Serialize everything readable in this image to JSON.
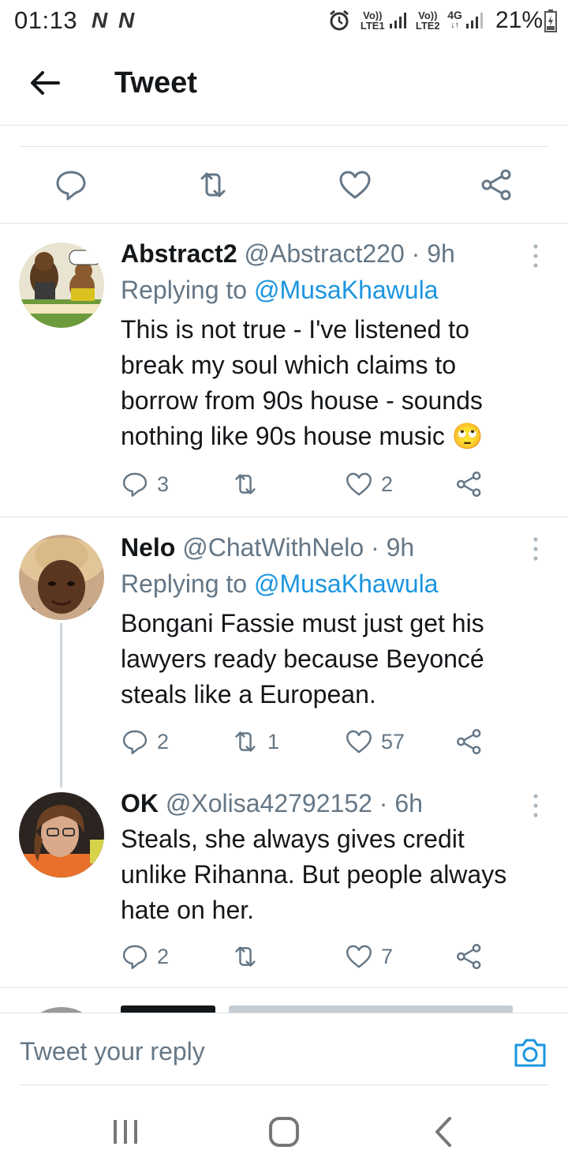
{
  "status_bar": {
    "time": "01:13",
    "n_icons": [
      "N",
      "N"
    ],
    "sim1_label": "Vo)) LTE1",
    "sim2_label": "Vo)) LTE2",
    "network": "4G",
    "battery_percent": "21%"
  },
  "header": {
    "title": "Tweet"
  },
  "tweets": [
    {
      "name": "Abstract2",
      "meta": "@Abstract220 · 9h",
      "replying_prefix": "Replying to ",
      "replying_to": "@MusaKhawula",
      "text": "This is not true - I've listened to break my soul which claims to borrow from 90s house - sounds nothing like 90s house music 🙄",
      "replies": "3",
      "retweets": "",
      "likes": "2"
    },
    {
      "name": "Nelo",
      "meta": "@ChatWithNelo · 9h",
      "replying_prefix": "Replying to ",
      "replying_to": "@MusaKhawula",
      "text": "Bongani Fassie must just get his lawyers ready because Beyoncé steals like a European.",
      "replies": "2",
      "retweets": "1",
      "likes": "57"
    },
    {
      "name": "OK",
      "meta": "@Xolisa42792152 · 6h",
      "text": "Steals, she always gives credit unlike Rihanna. But people always hate on her.",
      "replies": "2",
      "retweets": "",
      "likes": "7"
    }
  ],
  "reply_bar": {
    "placeholder": "Tweet your reply"
  },
  "colors": {
    "accent": "#1b95e0",
    "secondary_text": "#657786",
    "primary_text": "#14171a",
    "divider": "#dfe3e6"
  }
}
